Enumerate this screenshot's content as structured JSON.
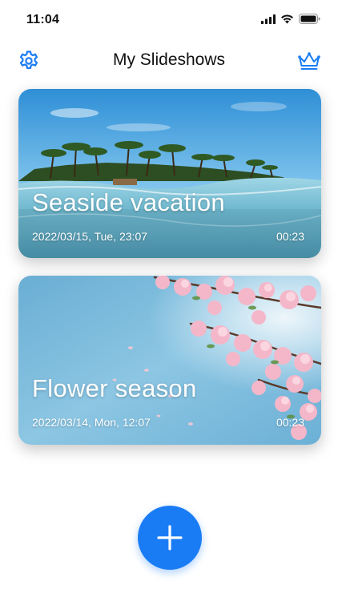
{
  "status_bar": {
    "time": "11:04"
  },
  "header": {
    "title": "My Slideshows"
  },
  "slideshows": [
    {
      "title": "Seaside vacation",
      "date": "2022/03/15, Tue, 23:07",
      "duration": "00:23"
    },
    {
      "title": "Flower season",
      "date": "2022/03/14, Mon, 12:07",
      "duration": "00:23"
    }
  ],
  "colors": {
    "accent": "#1a7cf5",
    "title_text": "#111111",
    "card_text": "#ffffff"
  },
  "icons": {
    "settings": "gear-icon",
    "premium": "crown-icon",
    "add": "plus-icon",
    "signal": "cellular-signal-icon",
    "wifi": "wifi-icon",
    "battery": "battery-icon"
  }
}
